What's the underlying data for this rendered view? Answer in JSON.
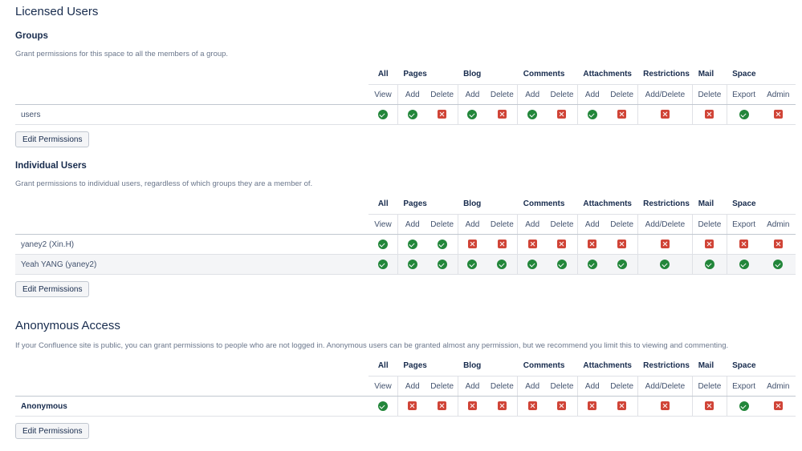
{
  "licensed_title": "Licensed Users",
  "anon_title": "Anonymous Access",
  "column_groups": [
    "All",
    "Pages",
    "Blog",
    "Comments",
    "Attachments",
    "Restrictions",
    "Mail",
    "Space"
  ],
  "permission_labels": [
    "View",
    "Add",
    "Delete",
    "Add",
    "Delete",
    "Add",
    "Delete",
    "Add",
    "Delete",
    "Add/Delete",
    "Delete",
    "Export",
    "Admin"
  ],
  "edit_label": "Edit Permissions",
  "sections": [
    {
      "key": "groups",
      "title": "Groups",
      "description": "Grant permissions for this space to all the members of a group.",
      "rows": [
        {
          "name": "users",
          "bold": false,
          "perms": [
            true,
            true,
            false,
            true,
            false,
            true,
            false,
            true,
            false,
            false,
            false,
            true,
            false
          ]
        }
      ]
    },
    {
      "key": "individual",
      "title": "Individual Users",
      "description": "Grant permissions to individual users, regardless of which groups they are a member of.",
      "rows": [
        {
          "name": "yaney2 (Xin.H)",
          "bold": false,
          "perms": [
            true,
            true,
            true,
            false,
            false,
            false,
            false,
            false,
            false,
            false,
            false,
            false,
            false
          ]
        },
        {
          "name": "Yeah YANG (yaney2)",
          "bold": false,
          "perms": [
            true,
            true,
            true,
            true,
            true,
            true,
            true,
            true,
            true,
            true,
            true,
            true,
            true
          ]
        }
      ]
    },
    {
      "key": "anonymous",
      "title": "",
      "description": "If your Confluence site is public, you can grant permissions to people who are not logged in. Anonymous users can be granted almost any permission, but we recommend you limit this to viewing and commenting.",
      "rows": [
        {
          "name": "Anonymous",
          "bold": true,
          "perms": [
            true,
            false,
            false,
            false,
            false,
            false,
            false,
            false,
            false,
            false,
            false,
            true,
            false
          ]
        }
      ]
    }
  ]
}
